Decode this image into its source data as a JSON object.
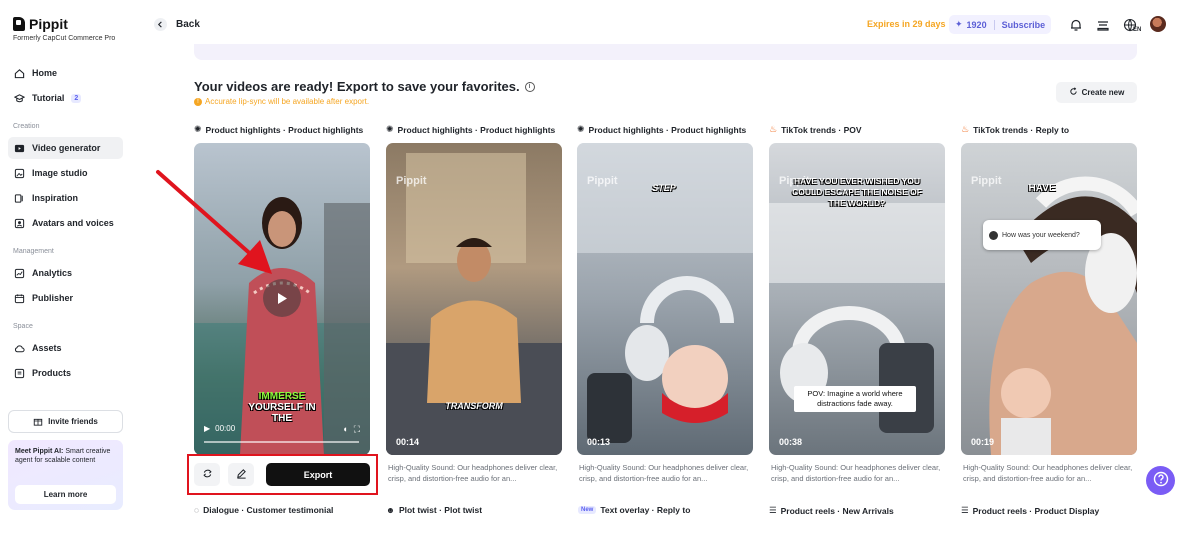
{
  "brand": {
    "name": "Pippit",
    "subtitle": "Formerly CapCut Commerce Pro"
  },
  "sidebar": {
    "home": "Home",
    "tutorial": "Tutorial",
    "tutorial_badge": "2",
    "section_creation": "Creation",
    "video_generator": "Video generator",
    "image_studio": "Image studio",
    "inspiration": "Inspiration",
    "avatars_voices": "Avatars and voices",
    "section_management": "Management",
    "analytics": "Analytics",
    "publisher": "Publisher",
    "section_space": "Space",
    "assets": "Assets",
    "products": "Products",
    "invite_friends": "Invite friends",
    "promo_title": "Meet Pippit AI:",
    "promo_body": "Smart creative agent for scalable content",
    "learn_more": "Learn more"
  },
  "topbar": {
    "back": "Back",
    "expires": "Expires in 29 days",
    "credits": "1920",
    "subscribe": "Subscribe",
    "lang": "EN"
  },
  "main": {
    "title": "Your videos are ready! Export to save your favorites.",
    "notice": "Accurate lip-sync will be available after export.",
    "create_new": "Create new",
    "export": "Export",
    "cards": [
      {
        "category": "Product highlights · Product highlights",
        "caption_top": "IMMERSE",
        "caption_bottom": "YOURSELF IN THE",
        "time": "00:00",
        "desc": ""
      },
      {
        "category": "Product highlights · Product highlights",
        "watermark": "Pippit",
        "caption": "TRANSFORM",
        "duration": "00:14",
        "desc": "High-Quality Sound: Our headphones deliver clear, crisp, and distortion-free audio for an..."
      },
      {
        "category": "Product highlights · Product highlights",
        "watermark": "Pippit",
        "caption": "STEP",
        "duration": "00:13",
        "desc": "High-Quality Sound: Our headphones deliver clear, crisp, and distortion-free audio for an..."
      },
      {
        "category": "TikTok trends · POV",
        "watermark": "Pippit",
        "caption": "HAVE YOU EVER WISHED YOU COULD ESCAPE THE NOISE OF THE WORLD?",
        "pov": "POV: Imagine a world where distractions fade away.",
        "duration": "00:38",
        "desc": "High-Quality Sound: Our headphones deliver clear, crisp, and distortion-free audio for an..."
      },
      {
        "category": "TikTok trends · Reply to",
        "watermark": "Pippit",
        "caption": "HAVE",
        "bubble": "How was your weekend?",
        "duration": "00:19",
        "desc": "High-Quality Sound: Our headphones deliver clear, crisp, and distortion-free audio for an..."
      }
    ],
    "bottom_labels": [
      "Dialogue · Customer testimonial",
      "Plot twist · Plot twist",
      "Text overlay · Reply to",
      "Product reels · New Arrivals",
      "Product reels · Product Display"
    ],
    "new_tag": "New"
  }
}
